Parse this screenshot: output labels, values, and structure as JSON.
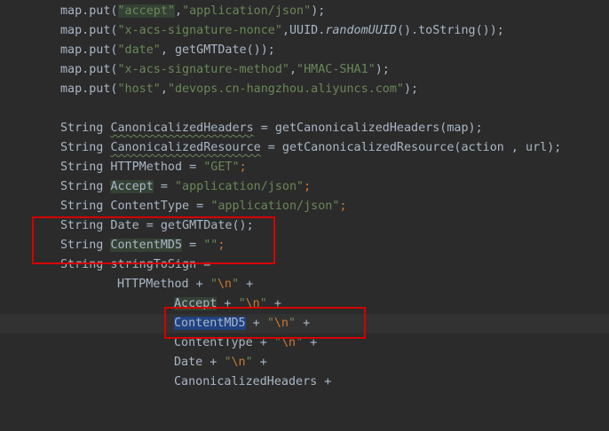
{
  "lines": {
    "l1": {
      "a": "map.put(",
      "b": "\"accept\"",
      "c": ",",
      "d": "\"application/json\"",
      "e": ");"
    },
    "l2": {
      "a": "map.put(",
      "b": "\"x-acs-signature-nonce\"",
      "c": ",UUID.",
      "d": "randomUUID",
      "e": "().toString());"
    },
    "l3": {
      "a": "map.put(",
      "b": "\"date\"",
      "c": ", getGMTDate());"
    },
    "l4": {
      "a": "map.put(",
      "b": "\"x-acs-signature-method\"",
      "c": ",",
      "d": "\"HMAC-SHA1\"",
      "e": ");"
    },
    "l5": {
      "a": "map.put(",
      "b": "\"host\"",
      "c": ",",
      "d": "\"devops.cn-hangzhou.aliyuncs.com\"",
      "e": ");"
    },
    "l7": {
      "a": "String ",
      "b": "CanonicalizedHeaders",
      "c": " = getCanonicalizedHeaders(map);"
    },
    "l8": {
      "a": "String ",
      "b": "CanonicalizedResource",
      "c": " = getCanonicalizedResource(action , url);"
    },
    "l9": {
      "a": "String HTTPMethod = ",
      "b": "\"GET\"",
      "c": ";"
    },
    "l10": {
      "a": "String ",
      "b": "Accept",
      "c": " = ",
      "d": "\"application/json\"",
      "e": ";"
    },
    "l11": {
      "a": "String ContentType = ",
      "b": "\"application/json\"",
      "c": ";"
    },
    "l12": {
      "a": "String Date = getGMTDate();"
    },
    "l13": {
      "a": "String ",
      "b": "ContentMD5",
      "c": " = ",
      "d": "\"\"",
      "e": ";"
    },
    "l14": {
      "a": "String stringToSign ="
    },
    "l15": {
      "a": "HTTPMethod + ",
      "b": "\"",
      "c": "\\n",
      "d": "\"",
      "e": " +"
    },
    "l16": {
      "a": "Accept",
      "b": " + ",
      "c": "\"",
      "d": "\\n",
      "e": "\"",
      "f": " +"
    },
    "l17": {
      "a": "ContentMD5",
      "b": " + ",
      "c": "\"",
      "d": "\\n",
      "e": "\"",
      "f": " +"
    },
    "l18": {
      "a": "ContentType + ",
      "b": "\"",
      "c": "\\n",
      "d": "\"",
      "e": " +"
    },
    "l19": {
      "a": "Date + ",
      "b": "\"",
      "c": "\\n",
      "d": "\"",
      "e": " +"
    },
    "l20": {
      "a": "CanonicalizedHeaders +"
    }
  },
  "theme": {
    "background": "#2b2b2b",
    "keyword": "#cc7832",
    "string": "#6a8759",
    "text": "#a9b7c6",
    "selection": "#214283",
    "annotation_box": "#d50000"
  }
}
